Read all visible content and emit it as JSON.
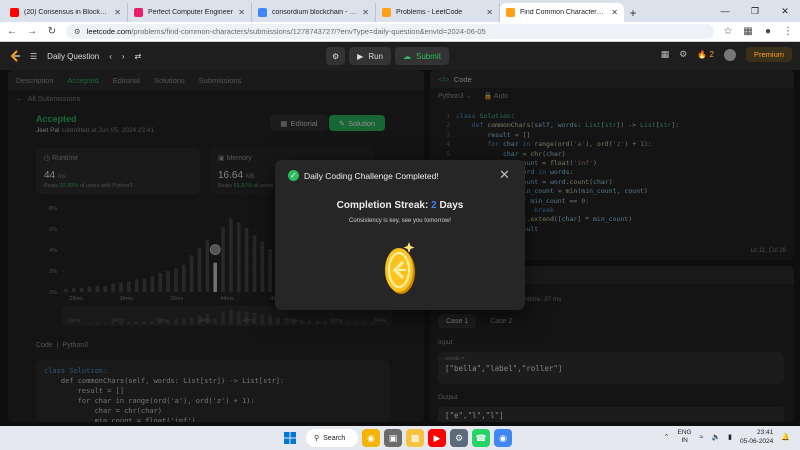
{
  "browser": {
    "tabs": [
      {
        "title": "(20) Consensus in Blockchain Te",
        "fav": "#ff0000",
        "active": false
      },
      {
        "title": "Perfect Computer Engineer",
        "fav": "#e91e63",
        "active": false
      },
      {
        "title": "consordium blockchain - Google",
        "fav": "#4285f4",
        "active": false
      },
      {
        "title": "Problems - LeetCode",
        "fav": "#ffa116",
        "active": false
      },
      {
        "title": "Find Common Characters - Leet",
        "fav": "#ffa116",
        "active": true
      }
    ],
    "new_tab": "+",
    "url_host": "leetcode.com",
    "url_path": "/problems/find-common-characters/submissions/1278743727/?envType=daily-question&envId=2024-06-05"
  },
  "lc": {
    "header_title": "Daily Question",
    "run_label": "Run",
    "submit_label": "Submit",
    "streak_count": "2",
    "premium_label": "Premium"
  },
  "left_panel": {
    "tabs": [
      "Description",
      "Accepted",
      "Editorial",
      "Solutions",
      "Submissions"
    ],
    "all_submissions": "All Submissions",
    "status": "Accepted",
    "submitter_name": "Jeet Pal",
    "submitted_at": "submitted at Jun 05, 2024 23:41",
    "editorial_btn": "Editorial",
    "solution_btn": "Solution",
    "runtime": {
      "label": "Runtime",
      "value": "44",
      "unit": "ms",
      "beats_prefix": "Beats",
      "beats_pct": "92.80%",
      "beats_suffix": "of users with Python3"
    },
    "memory": {
      "label": "Memory",
      "value": "16.64",
      "unit": "MB",
      "beats_prefix": "Beats",
      "beats_pct": "51.57%",
      "beats_suffix": "of users with Python3"
    },
    "code_label": "Code",
    "code_lang": "Python3",
    "code_preview": [
      "class Solution:",
      "    def commonChars(self, words: List[str]) -> List[str]:",
      "        result = []",
      "        for char in range(ord('a'), ord('z') + 1):",
      "            char = chr(char)",
      "            min_count = float('inf')"
    ]
  },
  "chart_data": {
    "type": "bar",
    "title": "",
    "xlabel": "",
    "ylabel": "",
    "y_ticks": [
      "8%",
      "6%",
      "4%",
      "2%",
      "0%"
    ],
    "x_ticks": [
      "29ms",
      "34ms",
      "39ms",
      "44ms",
      "49ms",
      "55ms",
      "60ms"
    ],
    "mini_x_ticks": [
      "29ms",
      "34ms",
      "39ms",
      "44ms",
      "49ms",
      "55ms",
      "60ms",
      "64ms"
    ],
    "ylim": [
      0,
      8
    ],
    "values": [
      0.3,
      0.4,
      0.4,
      0.5,
      0.6,
      0.6,
      0.8,
      0.9,
      1.0,
      1.2,
      1.3,
      1.5,
      1.8,
      2.0,
      2.3,
      2.6,
      3.5,
      4.2,
      5.0,
      2.8,
      6.2,
      7.0,
      6.6,
      6.1,
      5.4,
      4.8,
      4.1,
      3.5,
      3.0,
      2.5,
      2.1,
      1.8,
      1.5,
      1.3,
      1.1,
      0.9,
      0.8,
      0.6,
      0.5,
      0.4,
      0.3,
      0.3
    ],
    "highlight_index": 19
  },
  "editor": {
    "title": "Code",
    "lang": "Python3",
    "mode": "Auto",
    "cursor": "Ln 11, Col 26",
    "lines": [
      "1",
      "2",
      "3",
      "4",
      "5",
      "6",
      "7",
      "8",
      "9",
      "10",
      "11",
      "12",
      "13",
      "14"
    ]
  },
  "testcase": {
    "runtime_text": "Runtime: 37 ms",
    "cases": [
      "Case 1",
      "Case 2"
    ],
    "input_label": "Input",
    "var_name": "words =",
    "input_value": "[\"bella\",\"label\",\"roller\"]",
    "output_label": "Output",
    "output_value": "[\"e\",\"l\",\"l\"]"
  },
  "modal": {
    "title": "Daily Coding Challenge Completed!",
    "streak_prefix": "Completion Streak:",
    "streak_num": "2",
    "streak_suffix": "Days",
    "subtitle": "Consistency is key, see you tomorrow!"
  },
  "taskbar": {
    "search_label": "Search",
    "lang_top": "ENG",
    "lang_bottom": "IN",
    "time": "23:41",
    "date": "05-06-2024"
  },
  "colors": {
    "accent_green": "#2cbb5d",
    "accent_orange": "#ffa116",
    "streak_blue": "#3b82f6"
  }
}
